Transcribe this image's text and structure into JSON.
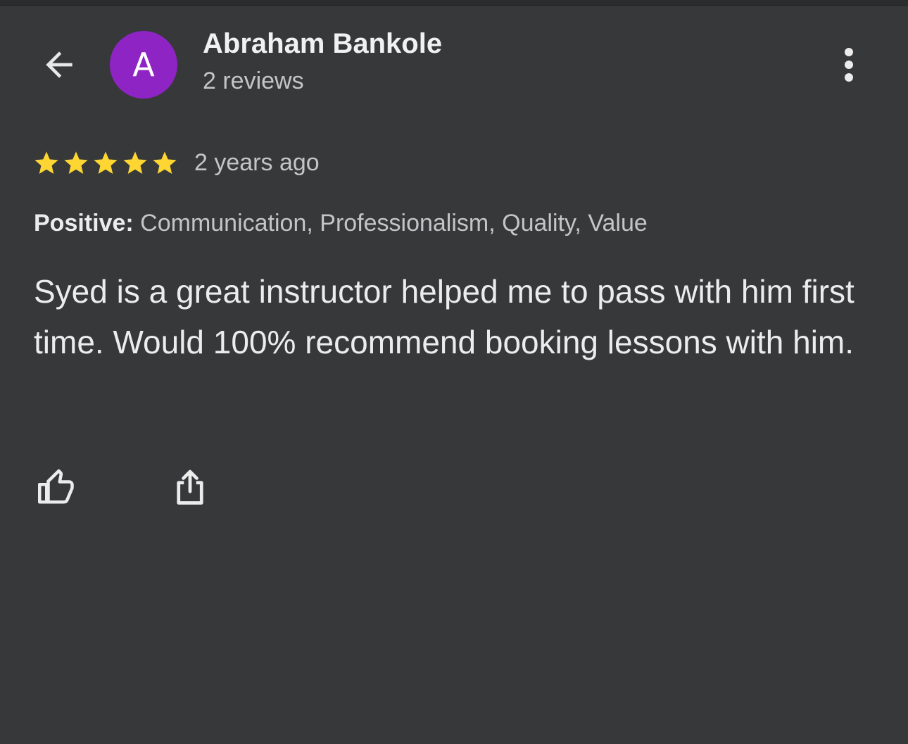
{
  "header": {
    "back_icon": "arrow-left-icon",
    "avatar_letter": "A",
    "avatar_color": "#8e24c4",
    "reviewer_name": "Abraham Bankole",
    "review_count": "2 reviews",
    "more_icon": "more-vertical-icon"
  },
  "review": {
    "rating": 5,
    "rating_max": 5,
    "star_color": "#fdd633",
    "date": "2 years ago",
    "attributes_label": "Positive:",
    "attributes_value": " Communication, Professionalism, Quality, Value",
    "text": "Syed is a great instructor helped me to pass with him first time. Would 100% recommend booking lessons with him."
  },
  "actions": {
    "like_icon": "thumbs-up-icon",
    "share_icon": "share-icon"
  }
}
